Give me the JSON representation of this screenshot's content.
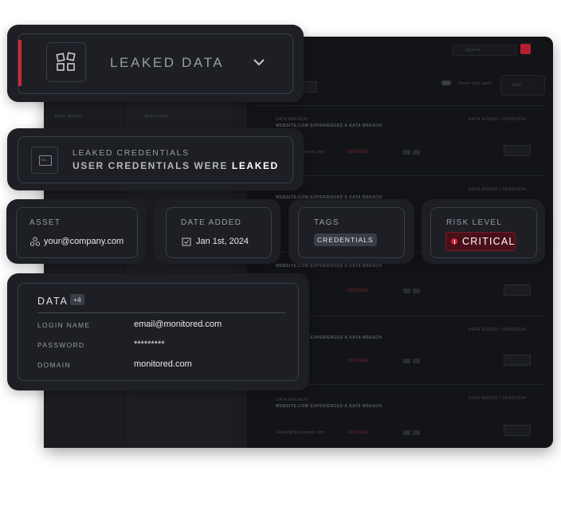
{
  "header": {
    "title": "LEAKED DATA"
  },
  "alert": {
    "line1": "LEAKED CREDENTIALS",
    "line2_prefix": "USER CREDENTIALS WERE",
    "line2_emph": "LEAKED",
    "icon_text": "Ora"
  },
  "meta": {
    "asset": {
      "label": "ASSET",
      "value": "your@company.com"
    },
    "date_added": {
      "label": "DATE ADDED",
      "value": "Jan 1st, 2024"
    },
    "tags": {
      "label": "TAGS",
      "value": "CREDENTIALS"
    },
    "risk": {
      "label": "RISK LEVEL",
      "value": "CRITICAL"
    }
  },
  "data": {
    "title": "DATA",
    "badge": "+4",
    "rows": [
      {
        "key": "LOGIN NAME",
        "value": "email@monitored.com"
      },
      {
        "key": "PASSWORD",
        "value": "*********"
      },
      {
        "key": "DOMAIN",
        "value": "monitored.com"
      }
    ]
  },
  "background": {
    "search": "Search",
    "toggle_label": "Show only open",
    "sort": "Sort",
    "filter_a": "Asset domain",
    "filter_b": "Event type",
    "row_title": "WEBSITE.COM EXPERIENCED A DATA BREACH",
    "row_sub": "DATA BREACH",
    "row_date": "DATE ADDED / 09/02/2024",
    "row_asset": "email@monitored.com",
    "row_risk": "CRITICAL",
    "resolve": "Resolve"
  },
  "colors": {
    "accent_red": "#d5253a",
    "card_bg": "#1d1f25",
    "border": "#3a3d46"
  }
}
